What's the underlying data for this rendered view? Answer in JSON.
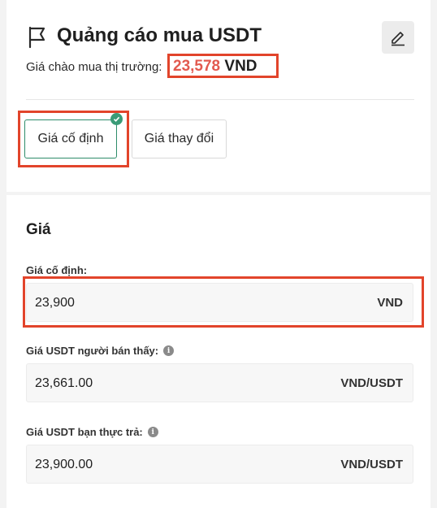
{
  "header": {
    "title": "Quảng cáo mua USDT",
    "market_label": "Giá chào mua thị trường:",
    "market_price": "23,578",
    "market_currency": "VND"
  },
  "price_type_tabs": [
    {
      "label": "Giá cố định",
      "selected": true
    },
    {
      "label": "Giá thay đổi",
      "selected": false
    }
  ],
  "price_section": {
    "title": "Giá",
    "fixed_price": {
      "label": "Giá cố định:",
      "value": "23,900",
      "unit": "VND"
    },
    "seller_sees": {
      "label": "Giá USDT người bán thấy:",
      "value": "23,661.00",
      "unit": "VND/USDT"
    },
    "you_pay": {
      "label": "Giá USDT bạn thực trả:",
      "value": "23,900.00",
      "unit": "VND/USDT"
    }
  },
  "icons": {
    "flag": "flag-icon",
    "edit": "pencil-icon",
    "check": "check-icon",
    "info": "info-icon"
  },
  "colors": {
    "highlight": "#e2442b",
    "market_price": "#e25a4f",
    "selected_tab_border": "#2e8c6a",
    "check_badge": "#3a9b77"
  }
}
